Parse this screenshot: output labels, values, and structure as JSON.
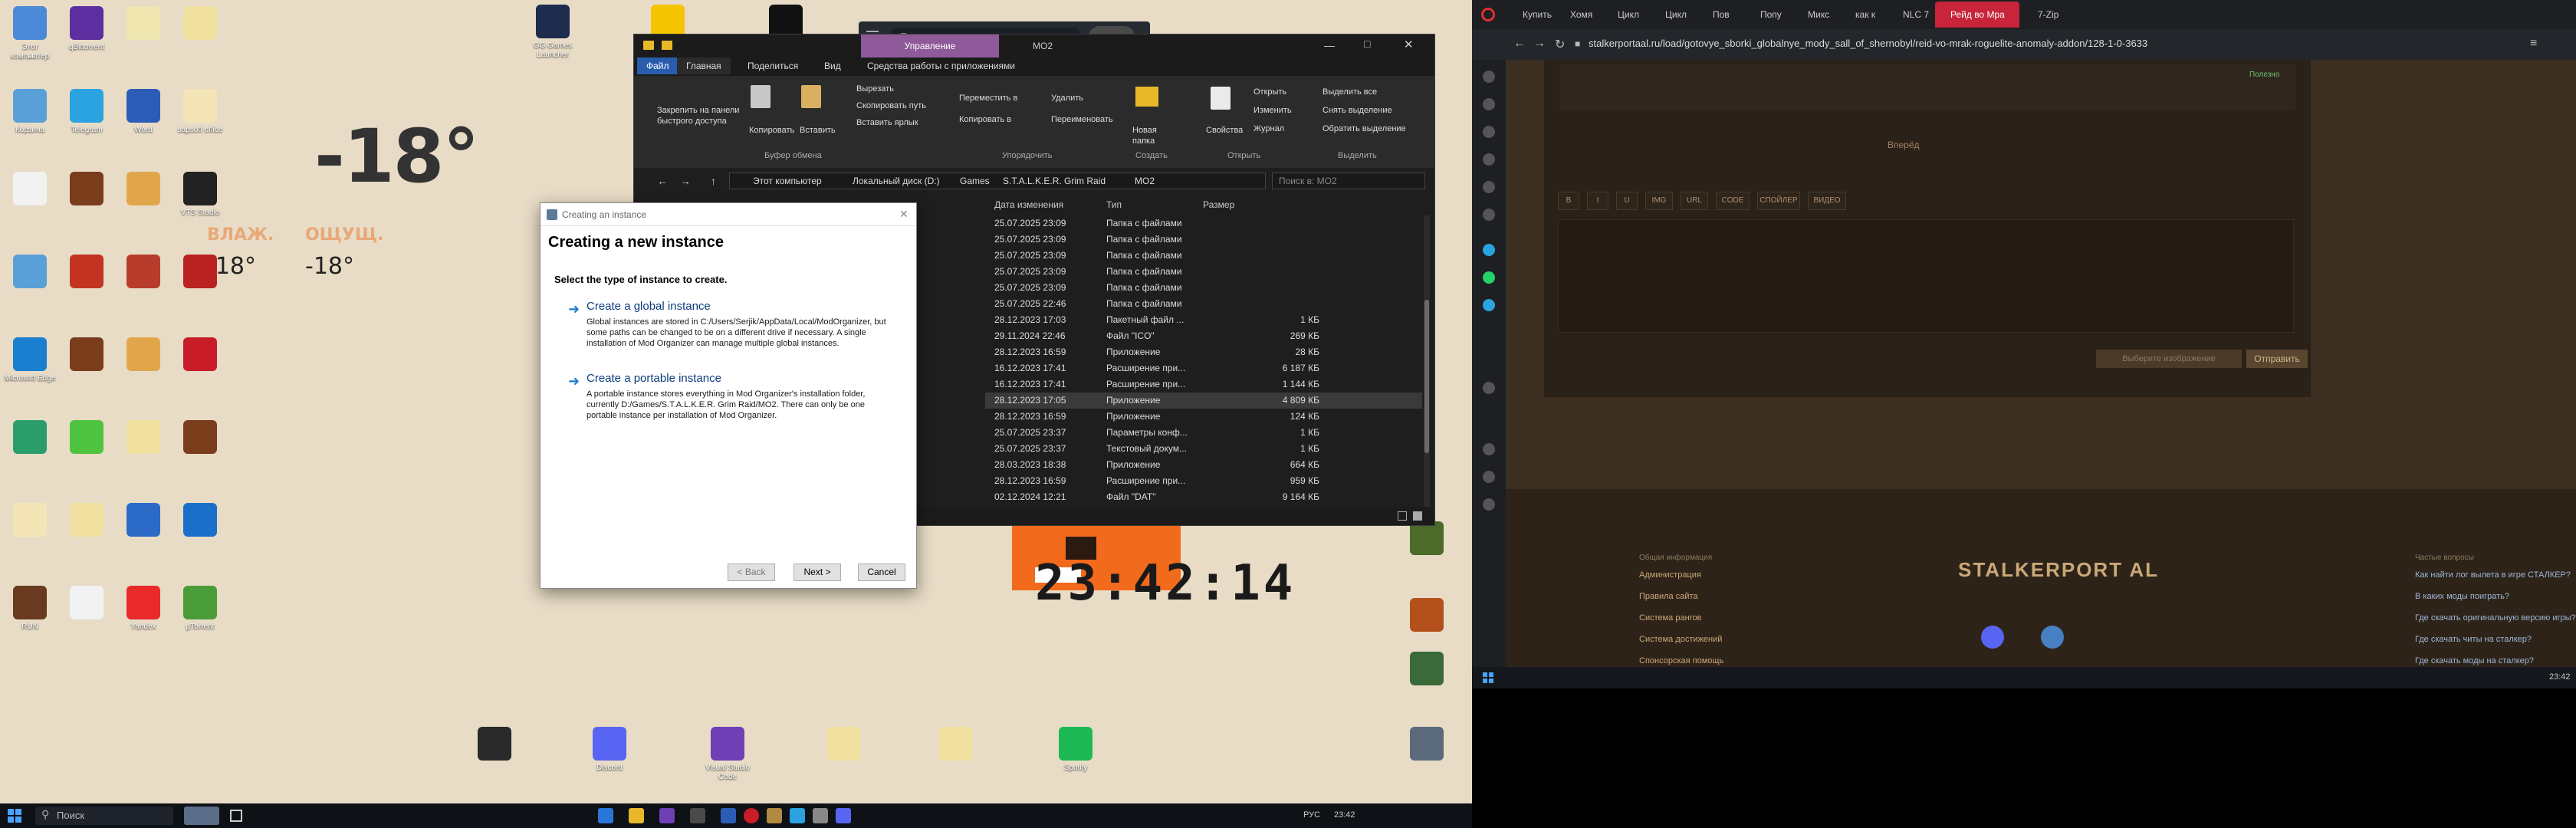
{
  "desktop": {
    "icons_left": [
      {
        "label": "Этот компьютер",
        "color": "#4a8ad8"
      },
      {
        "label": "qBittorrent",
        "color": "#5c2fa0"
      },
      {
        "label": "",
        "color": "#f0e7b0"
      },
      {
        "label": "",
        "color": "#f0e0a0"
      },
      {
        "label": "Корзина",
        "color": "#5aa0d8"
      },
      {
        "label": "Telegram",
        "color": "#2aa3e0"
      },
      {
        "label": "Word",
        "color": "#2b5db6"
      },
      {
        "label": "sapsoft office",
        "color": "#f4e5b6"
      },
      {
        "label": "",
        "color": "#f2f2f2"
      },
      {
        "label": "",
        "color": "#7a3d1c"
      },
      {
        "label": "",
        "color": "#e1a64c"
      },
      {
        "label": "VTS Studio",
        "color": "#222"
      },
      {
        "label": "",
        "color": "#5aa0d8"
      },
      {
        "label": "",
        "color": "#c23322"
      },
      {
        "label": "",
        "color": "#b83c2c"
      },
      {
        "label": "",
        "color": "#bb2222"
      },
      {
        "label": "Microsoft Edge",
        "color": "#1a7fd1"
      },
      {
        "label": "",
        "color": "#7a3d1c"
      },
      {
        "label": "",
        "color": "#e1a64c"
      },
      {
        "label": "",
        "color": "#c81d28"
      },
      {
        "label": "",
        "color": "#2b9d6c"
      },
      {
        "label": "",
        "color": "#4fc340"
      },
      {
        "label": "",
        "color": "#f0e0a0"
      },
      {
        "label": "",
        "color": "#7a3d1c"
      },
      {
        "label": "",
        "color": "#f4e5b6"
      },
      {
        "label": "",
        "color": "#f0e0a0"
      },
      {
        "label": "",
        "color": "#2c6ac8"
      },
      {
        "label": "",
        "color": "#1a70c8"
      },
      {
        "label": "RUN",
        "color": "#6a3a20"
      },
      {
        "label": "",
        "color": "#f2f2f2"
      },
      {
        "label": "Yandex",
        "color": "#e82a2a"
      },
      {
        "label": "µTorrent",
        "color": "#4a9b3a"
      }
    ],
    "icons_top": [
      {
        "label": "GG Games Launcher",
        "color": "#1e2d4e"
      },
      {
        "label": "",
        "color": "#f4c400"
      },
      {
        "label": "EPIC GAMES",
        "color": "#111"
      }
    ],
    "icons_bottom": [
      {
        "label": "",
        "color": "#2a2a2a"
      },
      {
        "label": "Discord",
        "color": "#5865f2"
      },
      {
        "label": "Visual Studio Code",
        "color": "#6f3fb5"
      },
      {
        "label": "",
        "color": "#f0e0a0"
      },
      {
        "label": "",
        "color": "#f0e0a0"
      },
      {
        "label": "Spotify",
        "color": "#1db954"
      },
      {
        "label": "",
        "color": "#5a6a7a"
      }
    ],
    "icons_right_col": [
      {
        "label": "",
        "color": "#4c6a28"
      },
      {
        "label": "",
        "color": "#b4501c"
      },
      {
        "label": "",
        "color": "#3a6a3a"
      }
    ],
    "weather": {
      "temp": "-18°",
      "small_left": "-18°",
      "small_right": "-18°",
      "lbl_left": "ВЛАЖ.",
      "lbl_right": "ОЩУЩ."
    },
    "clock": "23:42:14"
  },
  "explorer": {
    "title_tab_manage": "Управление",
    "title_folder": "MO2",
    "ribbon_tabs": [
      "Файл",
      "Главная",
      "Поделиться",
      "Вид",
      "Средства работы с приложениями"
    ],
    "ribbon_buttons": {
      "pin": "Закрепить на панели быстрого доступа",
      "copy": "Копировать",
      "paste": "Вставить",
      "cut": "Вырезать",
      "copy_path": "Скопировать путь",
      "paste_shortcut": "Вставить ярлык",
      "move_to": "Переместить в",
      "copy_to": "Копировать в",
      "delete": "Удалить",
      "rename": "Переименовать",
      "new_folder": "Новая папка",
      "properties": "Свойства",
      "open": "Открыть",
      "edit": "Изменить",
      "history": "Журнал",
      "select_all": "Выделить все",
      "select_none": "Снять выделение",
      "invert": "Обратить выделение"
    },
    "ribbon_groups": [
      "Буфер обмена",
      "Упорядочить",
      "Создать",
      "Открыть",
      "Выделить"
    ],
    "breadcrumb": [
      "Этот компьютер",
      "Локальный диск (D:)",
      "Games",
      "S.T.A.L.K.E.R. Grim Raid",
      "MO2"
    ],
    "search_placeholder": "Поиск в: MO2",
    "columns": [
      "Дата изменения",
      "Тип",
      "Размер"
    ],
    "rows": [
      {
        "date": "25.07.2025 23:09",
        "type": "Папка с файлами",
        "size": ""
      },
      {
        "date": "25.07.2025 23:09",
        "type": "Папка с файлами",
        "size": ""
      },
      {
        "date": "25.07.2025 23:09",
        "type": "Папка с файлами",
        "size": ""
      },
      {
        "date": "25.07.2025 23:09",
        "type": "Папка с файлами",
        "size": ""
      },
      {
        "date": "25.07.2025 23:09",
        "type": "Папка с файлами",
        "size": ""
      },
      {
        "date": "25.07.2025 22:46",
        "type": "Папка с файлами",
        "size": ""
      },
      {
        "date": "28.12.2023 17:03",
        "type": "Пакетный файл ...",
        "size": "1 КБ"
      },
      {
        "date": "29.11.2024 22:46",
        "type": "Файл \"ICO\"",
        "size": "269 КБ"
      },
      {
        "date": "28.12.2023 16:59",
        "type": "Приложение",
        "size": "28 КБ"
      },
      {
        "date": "16.12.2023 17:41",
        "type": "Расширение при...",
        "size": "6 187 КБ"
      },
      {
        "date": "16.12.2023 17:41",
        "type": "Расширение при...",
        "size": "1 144 КБ"
      },
      {
        "date": "28.12.2023 17:05",
        "type": "Приложение",
        "size": "4 809 КБ"
      },
      {
        "date": "28.12.2023 16:59",
        "type": "Приложение",
        "size": "124 КБ"
      },
      {
        "date": "25.07.2025 23:37",
        "type": "Параметры конф...",
        "size": "1 КБ"
      },
      {
        "date": "25.07.2025 23:37",
        "type": "Текстовый докум...",
        "size": "1 КБ"
      },
      {
        "date": "28.03.2023 18:38",
        "type": "Приложение",
        "size": "664 КБ"
      },
      {
        "date": "28.12.2023 16:59",
        "type": "Расширение при...",
        "size": "959 КБ"
      },
      {
        "date": "02.12.2024 12:21",
        "type": "Файл \"DAT\"",
        "size": "9 164 КБ"
      }
    ]
  },
  "dialog": {
    "window_title": "Creating an instance",
    "heading": "Creating a new instance",
    "subheading": "Select the type of instance to create.",
    "global_title": "Create a global instance",
    "global_desc": "Global instances are stored in C:/Users/Serjik/AppData/Local/ModOrganizer, but some paths can be changed to be on a different drive if necessary. A single installation of Mod Organizer can manage multiple global instances.",
    "portable_title": "Create a portable instance",
    "portable_desc": "A portable instance stores everything in Mod Organizer's installation folder, currently D:/Games/S.T.A.L.K.E.R. Grim Raid/MO2. There can only be one portable instance per installation of Mod Organizer.",
    "back": "< Back",
    "next": "Next >",
    "cancel": "Cancel"
  },
  "left_taskbar": {
    "search": "Поиск",
    "lang": "РУС",
    "time": "23:42"
  },
  "search_bar_top": {
    "placeholder": "Поиск"
  },
  "browser": {
    "tabs": [
      "Купить",
      "Хомя",
      "Цикл",
      "Цикл",
      "Пов",
      "Попу",
      "Микс",
      "как к",
      "NLC 7",
      "Рейд во Мра",
      "7-Zip"
    ],
    "url": "stalkerportaal.ru/load/gotovye_sborki_globalnye_mody_sall_of_shernobyl/reid-vo-mrak-roguelite-anomaly-addon/128-1-0-3633",
    "pager_next": "Вперёд",
    "editor_buttons": [
      "B",
      "I",
      "U",
      "IMG",
      "URL",
      "CODE",
      "СПОЙЛЕР",
      "ВИДЕО"
    ],
    "send": "Отправить",
    "choose_files": "Выберите изображение",
    "helpful": "Полезно",
    "logo": "STALKERPORT AL",
    "footer_section": "Общая информация",
    "footer_links": [
      "Администрация",
      "Правила сайта",
      "Система рангов",
      "Система достижений",
      "Спонсорская помощь"
    ],
    "faq_title": "Частые вопросы",
    "faq": [
      "Как найти лог вылета в игре СТАЛКЕР?",
      "В каких моды поиграть?",
      "Где скачать оригинальную версию игры?",
      "Где скачать читы на сталкер?",
      "Где скачать моды на сталкер?"
    ],
    "taskbar_time": "23:42"
  }
}
